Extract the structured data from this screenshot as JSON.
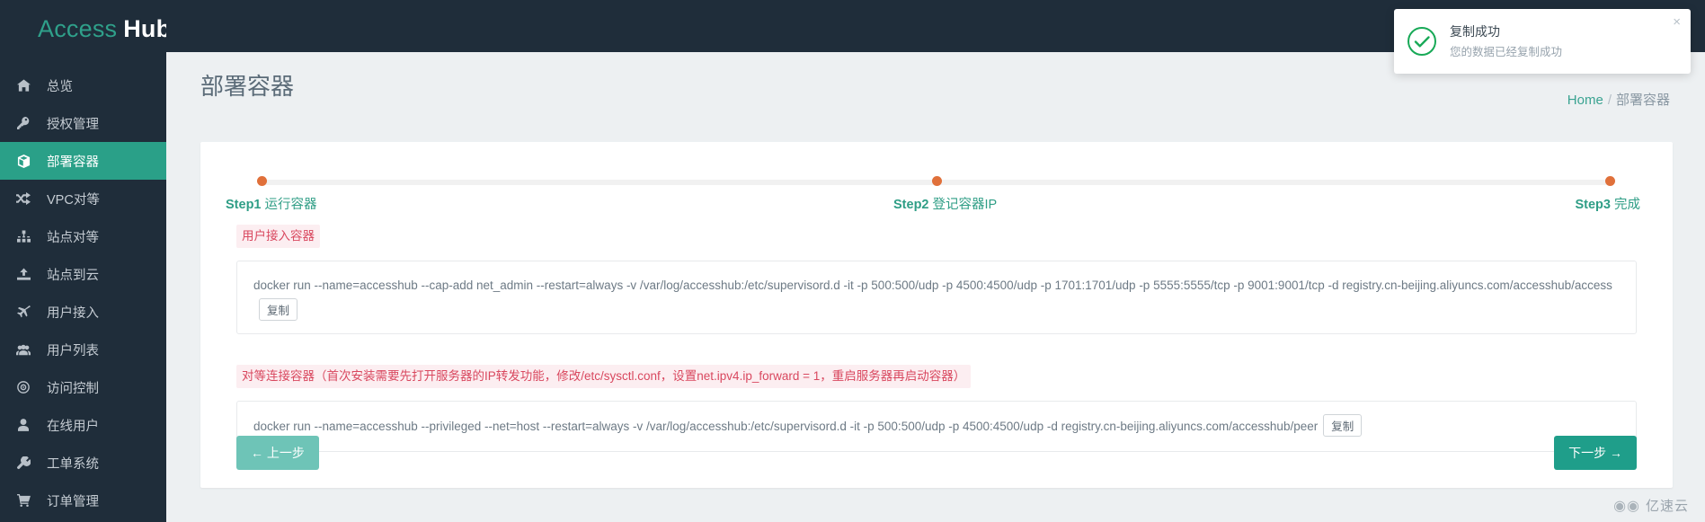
{
  "brand": {
    "part1": "Access",
    "part2": "Hub"
  },
  "sidebar": {
    "items": [
      {
        "label": "总览",
        "icon": "home-icon",
        "active": false
      },
      {
        "label": "授权管理",
        "icon": "key-icon",
        "active": false
      },
      {
        "label": "部署容器",
        "icon": "box-icon",
        "active": true
      },
      {
        "label": "VPC对等",
        "icon": "shuffle-icon",
        "active": false
      },
      {
        "label": "站点对等",
        "icon": "sitemap-icon",
        "active": false
      },
      {
        "label": "站点到云",
        "icon": "upload-icon",
        "active": false
      },
      {
        "label": "用户接入",
        "icon": "plane-icon",
        "active": false
      },
      {
        "label": "用户列表",
        "icon": "users-icon",
        "active": false
      },
      {
        "label": "访问控制",
        "icon": "target-icon",
        "active": false
      },
      {
        "label": "在线用户",
        "icon": "user-icon",
        "active": false
      },
      {
        "label": "工单系统",
        "icon": "wrench-icon",
        "active": false
      },
      {
        "label": "订单管理",
        "icon": "cart-icon",
        "active": false
      }
    ]
  },
  "header": {
    "title": "部署容器",
    "breadcrumb_home": "Home",
    "breadcrumb_sep": "/",
    "breadcrumb_current": "部署容器"
  },
  "stepper": {
    "steps": [
      {
        "num": "Step1",
        "name": " 运行容器"
      },
      {
        "num": "Step2",
        "name": " 登记容器IP"
      },
      {
        "num": "Step3",
        "name": " 完成"
      }
    ]
  },
  "blocks": [
    {
      "tag": "用户接入容器",
      "command": "docker run --name=accesshub --cap-add net_admin --restart=always -v /var/log/accesshub:/etc/supervisord.d -it -p 500:500/udp -p 4500:4500/udp -p 1701:1701/udp -p 5555:5555/tcp -p 9001:9001/tcp -d registry.cn-beijing.aliyuncs.com/accesshub/access",
      "copy_label": "复制"
    },
    {
      "tag": "对等连接容器（首次安装需要先打开服务器的IP转发功能，修改/etc/sysctl.conf，设置net.ipv4.ip_forward = 1，重启服务器再启动容器）",
      "command": "docker run --name=accesshub --privileged --net=host --restart=always -v /var/log/accesshub:/etc/supervisord.d -it -p 500:500/udp -p 4500:4500/udp -d registry.cn-beijing.aliyuncs.com/accesshub/peer",
      "copy_label": "复制"
    }
  ],
  "footer": {
    "prev_label": "← 上一步",
    "next_label": "下一步 →"
  },
  "toast": {
    "title": "复制成功",
    "desc": "您的数据已经复制成功",
    "close": "×"
  },
  "watermark": {
    "text": "亿速云"
  },
  "colors": {
    "sidebar_bg": "#1f2d3a",
    "accent_green": "#2aa088",
    "step_dot": "#e0703a",
    "tag_red": "#d9485f",
    "success_green": "#18a957"
  }
}
